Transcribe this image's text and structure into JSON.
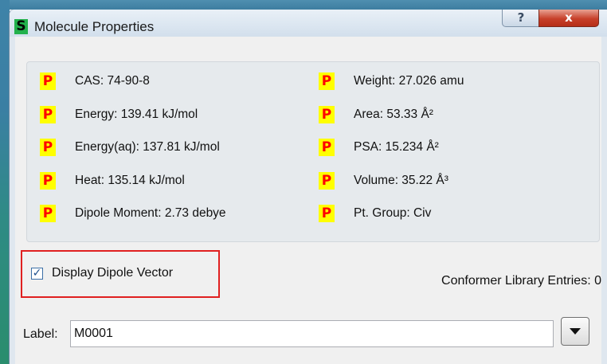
{
  "window": {
    "title": "Molecule Properties",
    "app_icon_letter": "S",
    "help_glyph": "?",
    "close_glyph": "x"
  },
  "properties": {
    "badge": "P",
    "left": [
      "CAS: 74-90-8",
      "Energy: 139.41 kJ/mol",
      "Energy(aq): 137.81 kJ/mol",
      "Heat: 135.14 kJ/mol",
      "Dipole Moment: 2.73 debye"
    ],
    "right": [
      "Weight: 27.026 amu",
      "Area: 53.33 Å²",
      "PSA: 15.234 Å²",
      "Volume: 35.22 Å³",
      "Pt. Group: Civ"
    ]
  },
  "dipole": {
    "label": "Display Dipole Vector",
    "checked": true
  },
  "conformer": {
    "text": "Conformer Library Entries: 0"
  },
  "label_field": {
    "caption": "Label:",
    "value": "M0001"
  },
  "colors": {
    "badge_bg": "#ffff00",
    "badge_fg": "#ff0000",
    "highlight_border": "#e02020",
    "close_button": "#c7402a",
    "app_icon": "#22b14c"
  },
  "icons": {
    "app": "spartan-s-icon",
    "help": "help-icon",
    "close": "close-icon",
    "dropdown": "triangle-down-icon"
  }
}
